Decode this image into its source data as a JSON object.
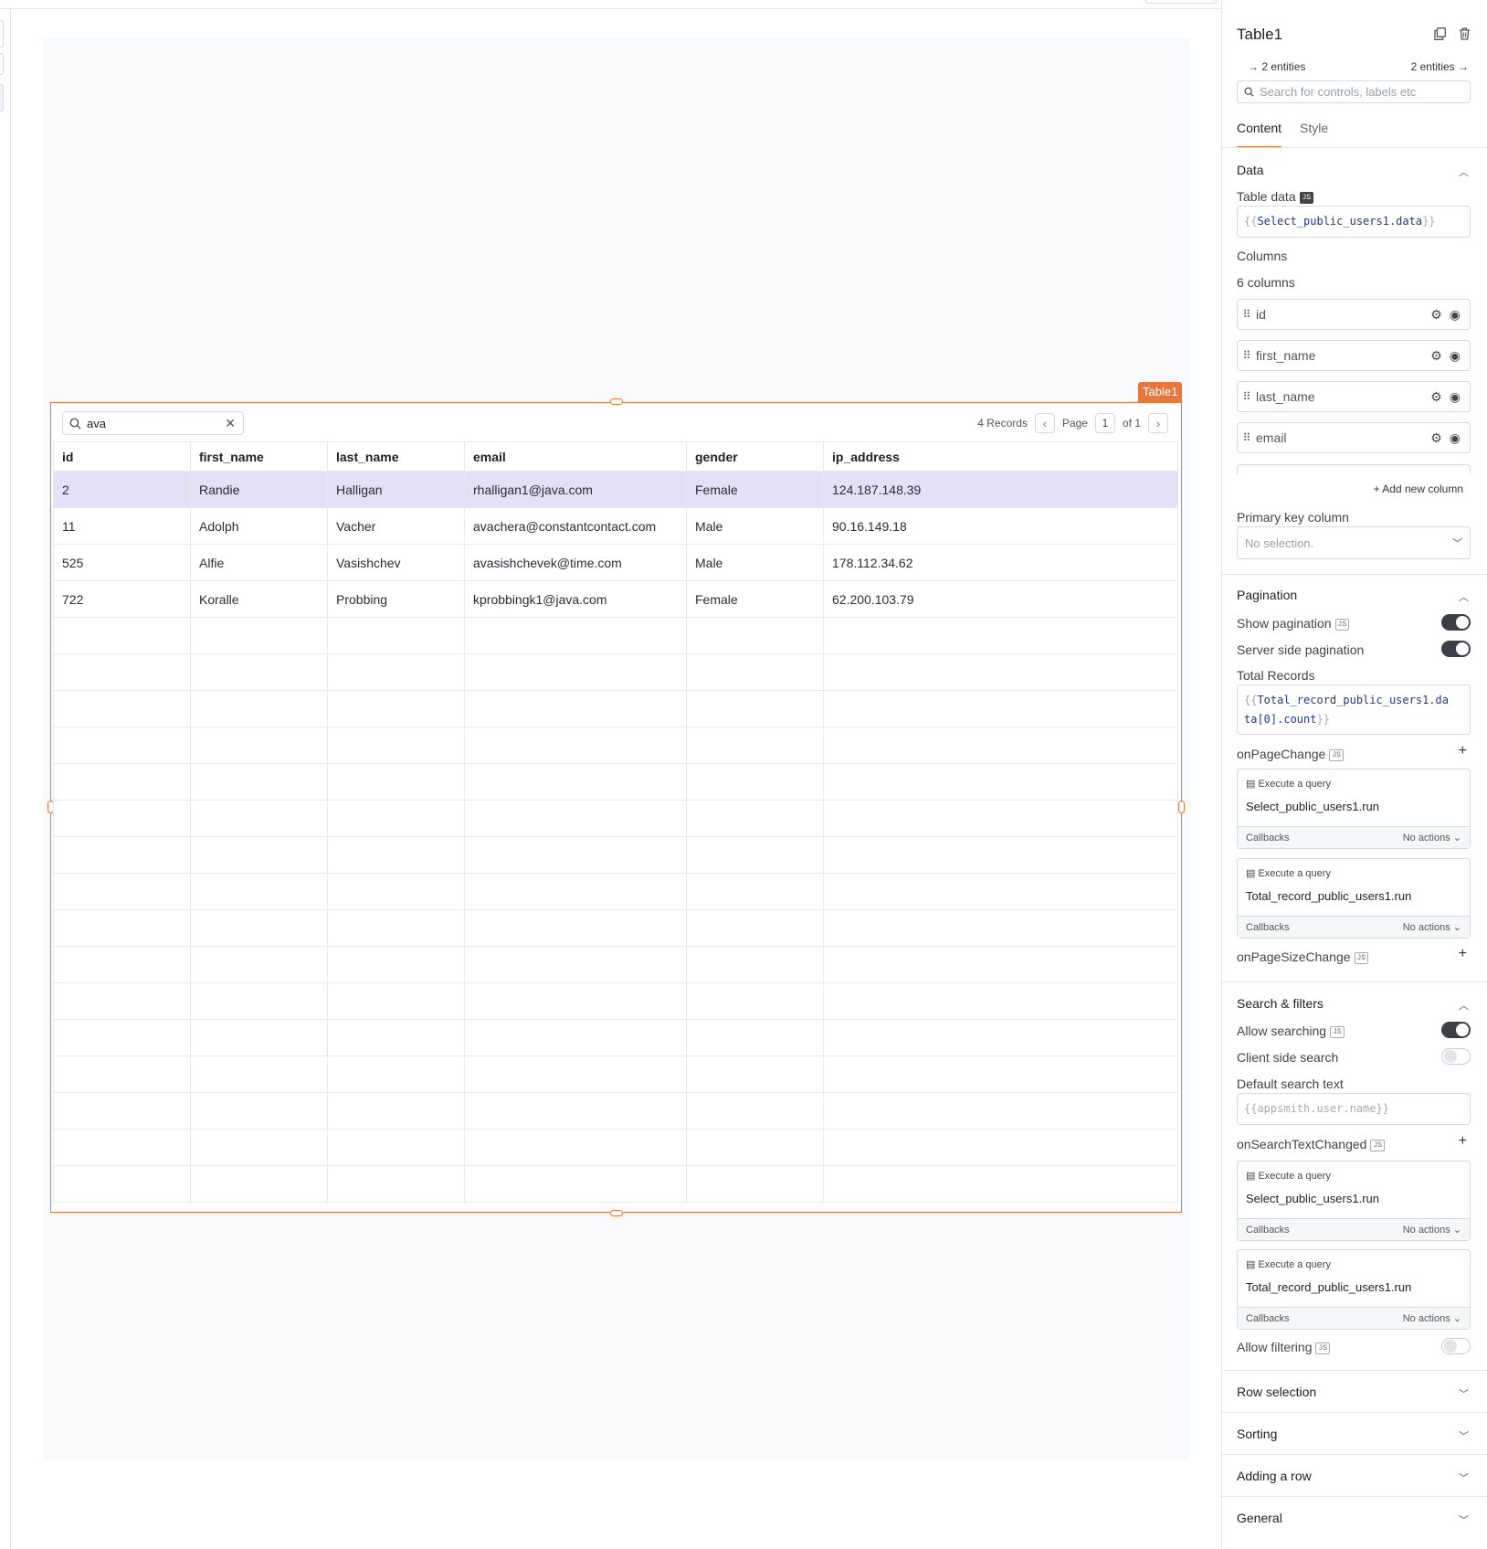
{
  "widget": {
    "tag": "Table1"
  },
  "table": {
    "search_value": "ava",
    "records": "4 Records",
    "page_label": "Page",
    "page_num": "1",
    "of_label": "of 1",
    "headers": [
      "id",
      "first_name",
      "last_name",
      "email",
      "gender",
      "ip_address"
    ],
    "rows": [
      [
        "2",
        "Randie",
        "Halligan",
        "rhalligan1@java.com",
        "Female",
        "124.187.148.39"
      ],
      [
        "11",
        "Adolph",
        "Vacher",
        "avachera@constantcontact.com",
        "Male",
        "90.16.149.18"
      ],
      [
        "525",
        "Alfie",
        "Vasishchev",
        "avasishchevek@time.com",
        "Male",
        "178.112.34.62"
      ],
      [
        "722",
        "Koralle",
        "Probbing",
        "kprobbingk1@java.com",
        "Female",
        "62.200.103.79"
      ]
    ]
  },
  "panel": {
    "title": "Table1",
    "entities_left": "2 entities",
    "entities_right": "2 entities",
    "search_placeholder": "Search for controls, labels etc",
    "tab_content": "Content",
    "tab_style": "Style",
    "data_section": "Data",
    "table_data_label": "Table data",
    "table_data_value": "Select_public_users1.data",
    "columns_label": "Columns",
    "columns_count": "6 columns",
    "columns": [
      "id",
      "first_name",
      "last_name",
      "email"
    ],
    "add_column": "Add new column",
    "primary_key_label": "Primary key column",
    "primary_key_placeholder": "No selection.",
    "pagination_section": "Pagination",
    "show_pagination": "Show pagination",
    "server_side_pagination": "Server side pagination",
    "total_records_label": "Total Records",
    "total_records_line1": "Total_record_public_users1.da",
    "total_records_line2": "ta[0].count",
    "on_page_change": "onPageChange",
    "on_page_size_change": "onPageSizeChange",
    "execute_query": "Execute a query",
    "query_select": "Select_public_users1.run",
    "query_total": "Total_record_public_users1.run",
    "callbacks": "Callbacks",
    "no_actions": "No actions",
    "search_filters_section": "Search & filters",
    "allow_searching": "Allow searching",
    "client_side_search": "Client side search",
    "default_search_label": "Default search text",
    "default_search_placeholder": "{{appsmith.user.name}}",
    "on_search_text_changed": "onSearchTextChanged",
    "allow_filtering": "Allow filtering",
    "row_selection": "Row selection",
    "sorting": "Sorting",
    "adding_row": "Adding a row",
    "general": "General",
    "js_badge": "JS"
  }
}
